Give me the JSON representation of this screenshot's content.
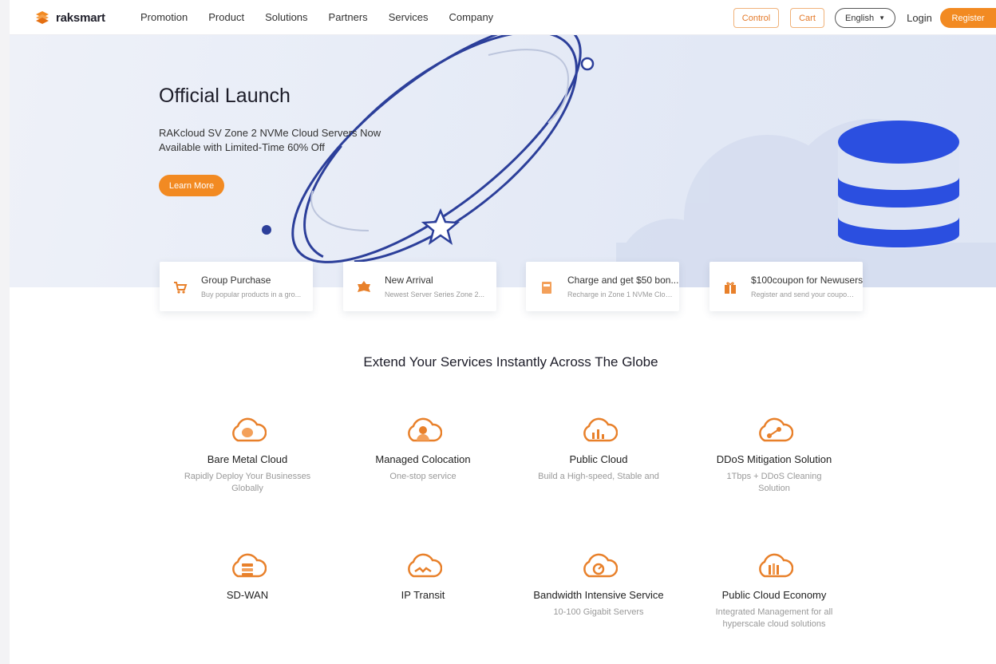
{
  "header": {
    "logo_text": "raksmart",
    "nav": [
      "Promotion",
      "Product",
      "Solutions",
      "Partners",
      "Services",
      "Company"
    ],
    "console_label": "Control",
    "cart_label": "Cart",
    "language_label": "English",
    "login_label": "Login",
    "register_label": "Register"
  },
  "hero": {
    "title": "Official Launch",
    "subtitle_line1": "RAKcloud SV Zone 2 NVMe Cloud Servers Now",
    "subtitle_line2": "Available with Limited-Time 60% Off",
    "button_label": "Learn More"
  },
  "promo_cards": [
    {
      "title": "Group Purchase",
      "desc": "Buy popular products in a gro..."
    },
    {
      "title": "New Arrival",
      "desc": "Newest Server Series Zone 2..."
    },
    {
      "title": "Charge and get $50 bon...",
      "desc": "Recharge in Zone 1 NVMe Cloud..."
    },
    {
      "title": "$100coupon for Newusers",
      "desc": "Register and send your coupon..."
    }
  ],
  "services_title": "Extend Your Services Instantly Across The Globe",
  "services": [
    {
      "name": "Bare Metal Cloud",
      "desc": "Rapidly Deploy Your Businesses Globally",
      "icon": "bare-metal-cloud-icon"
    },
    {
      "name": "Managed Colocation",
      "desc": "One-stop service",
      "icon": "managed-colocation-icon"
    },
    {
      "name": "Public Cloud",
      "desc": "Build a High-speed, Stable and",
      "icon": "public-cloud-icon"
    },
    {
      "name": "DDoS Mitigation Solution",
      "desc": "1Tbps + DDoS Cleaning Solution",
      "icon": "ddos-mitigation-icon"
    },
    {
      "name": "SD-WAN",
      "desc": "",
      "icon": "sd-wan-icon"
    },
    {
      "name": "IP Transit",
      "desc": "",
      "icon": "ip-transit-icon"
    },
    {
      "name": "Bandwidth Intensive Service",
      "desc": "10-100 Gigabit Servers",
      "icon": "bandwidth-service-icon"
    },
    {
      "name": "Public Cloud Economy",
      "desc": "Integrated Management for all hyperscale cloud solutions",
      "icon": "public-cloud-economy-icon"
    }
  ],
  "colors": {
    "accent": "#f28a22",
    "ring": "#2c3f9a",
    "db": "#2b4fe0"
  }
}
